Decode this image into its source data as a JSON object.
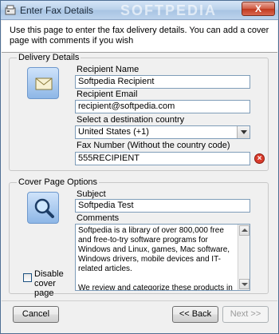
{
  "window": {
    "title": "Enter Fax Details",
    "watermark": "SOFTPEDIA",
    "close_glyph": "X"
  },
  "instructions": "Use this page to enter the fax delivery details. You can add a cover page with comments if you wish",
  "delivery": {
    "legend": "Delivery Details",
    "icon": "envelope-icon",
    "recipient_name_label": "Recipient Name",
    "recipient_name_value": "Softpedia Recipient",
    "recipient_email_label": "Recipient Email",
    "recipient_email_value": "recipient@softpedia.com",
    "country_label": "Select a destination country",
    "country_value": "United States (+1)",
    "fax_label": "Fax Number (Without the country code)",
    "fax_value": "555RECIPIENT",
    "error_icon": "error-icon"
  },
  "cover": {
    "legend": "Cover Page Options",
    "icon": "magnifier-icon",
    "subject_label": "Subject",
    "subject_value": "Softpedia Test",
    "comments_label": "Comments",
    "comments_value": "Softpedia is a library of over 800,000 free and free-to-try software programs for Windows and Linux, games, Mac software, Windows drivers, mobile devices and IT-related articles.\n\nWe review and categorize these products in order to allow the visitor/user to find the exact product they and their system needs.",
    "disable_label": "Disable cover page",
    "disable_checked": false
  },
  "buttons": {
    "cancel": "Cancel",
    "back": "<< Back",
    "next": "Next >>"
  }
}
